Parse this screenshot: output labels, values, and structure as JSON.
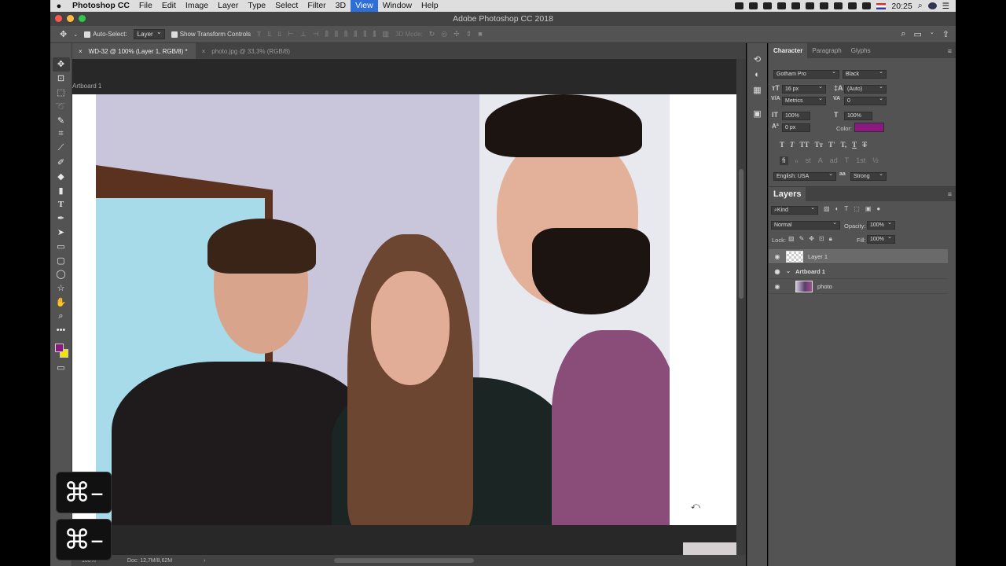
{
  "menubar": {
    "app": "Photoshop CC",
    "items": [
      "File",
      "Edit",
      "Image",
      "Layer",
      "Type",
      "Select",
      "Filter",
      "3D",
      "View",
      "Window",
      "Help"
    ],
    "active_item": "View",
    "clock": "20:25"
  },
  "window": {
    "title": "Adobe Photoshop CC 2018"
  },
  "options": {
    "auto_select_label": "Auto-Select:",
    "auto_select_value": "Layer",
    "transform_label": "Show Transform Controls",
    "mode_3d_label": "3D Mode:"
  },
  "tabs": [
    {
      "label": "WD-32 @ 100% (Layer 1, RGB/8) *",
      "active": true
    },
    {
      "label": "photo.jpg @ 33,3% (RGB/8)",
      "active": false
    }
  ],
  "canvas": {
    "artboard_label": "Artboard 1"
  },
  "status": {
    "zoom": "100%",
    "doc": "Doc: 12,7M/8,62M"
  },
  "shortcut_overlay": {
    "keys": "⌘–"
  },
  "character": {
    "tabs": [
      "Character",
      "Paragraph",
      "Glyphs"
    ],
    "font_family": "Gotham Pro",
    "font_style": "Black",
    "size": "16 px",
    "leading": "(Auto)",
    "kerning": "Metrics",
    "tracking": "0",
    "vscale": "100%",
    "hscale": "100%",
    "baseline": "0 px",
    "color_label": "Color:",
    "color": "#8b1a80",
    "language": "English: USA",
    "antialias": "Strong",
    "styles": [
      "T",
      "T",
      "TT",
      "Tт",
      "T'",
      "T,",
      "T",
      "T"
    ],
    "opentype": [
      "fi",
      "ℴ",
      "st",
      "A",
      "ad",
      "T",
      "1st",
      "½"
    ]
  },
  "layers": {
    "title": "Layers",
    "filter": "Kind",
    "blend": "Normal",
    "opacity_label": "Opacity:",
    "opacity": "100%",
    "lock_label": "Lock:",
    "fill_label": "Fill:",
    "fill": "100%",
    "rows": [
      {
        "name": "Layer 1",
        "kind": "transparent",
        "selected": true
      },
      {
        "name": "Artboard 1",
        "kind": "artboard",
        "selected": false
      },
      {
        "name": "photo",
        "kind": "photo",
        "selected": false
      }
    ]
  }
}
